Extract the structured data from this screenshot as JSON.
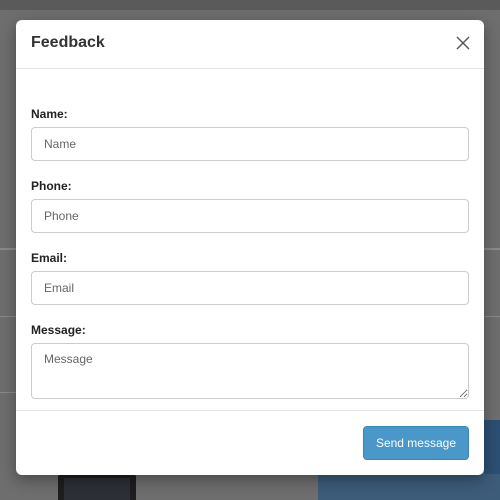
{
  "modal": {
    "title": "Feedback",
    "close_icon": "close-icon"
  },
  "form": {
    "fields": [
      {
        "label": "Name:",
        "placeholder": "Name",
        "value": ""
      },
      {
        "label": "Phone:",
        "placeholder": "Phone",
        "value": ""
      },
      {
        "label": "Email:",
        "placeholder": "Email",
        "value": ""
      },
      {
        "label": "Message:",
        "placeholder": "Message",
        "value": ""
      }
    ]
  },
  "footer": {
    "send_label": "Send message"
  },
  "colors": {
    "button_bg": "#4a97c9",
    "overlay": "#6e6e6e"
  }
}
